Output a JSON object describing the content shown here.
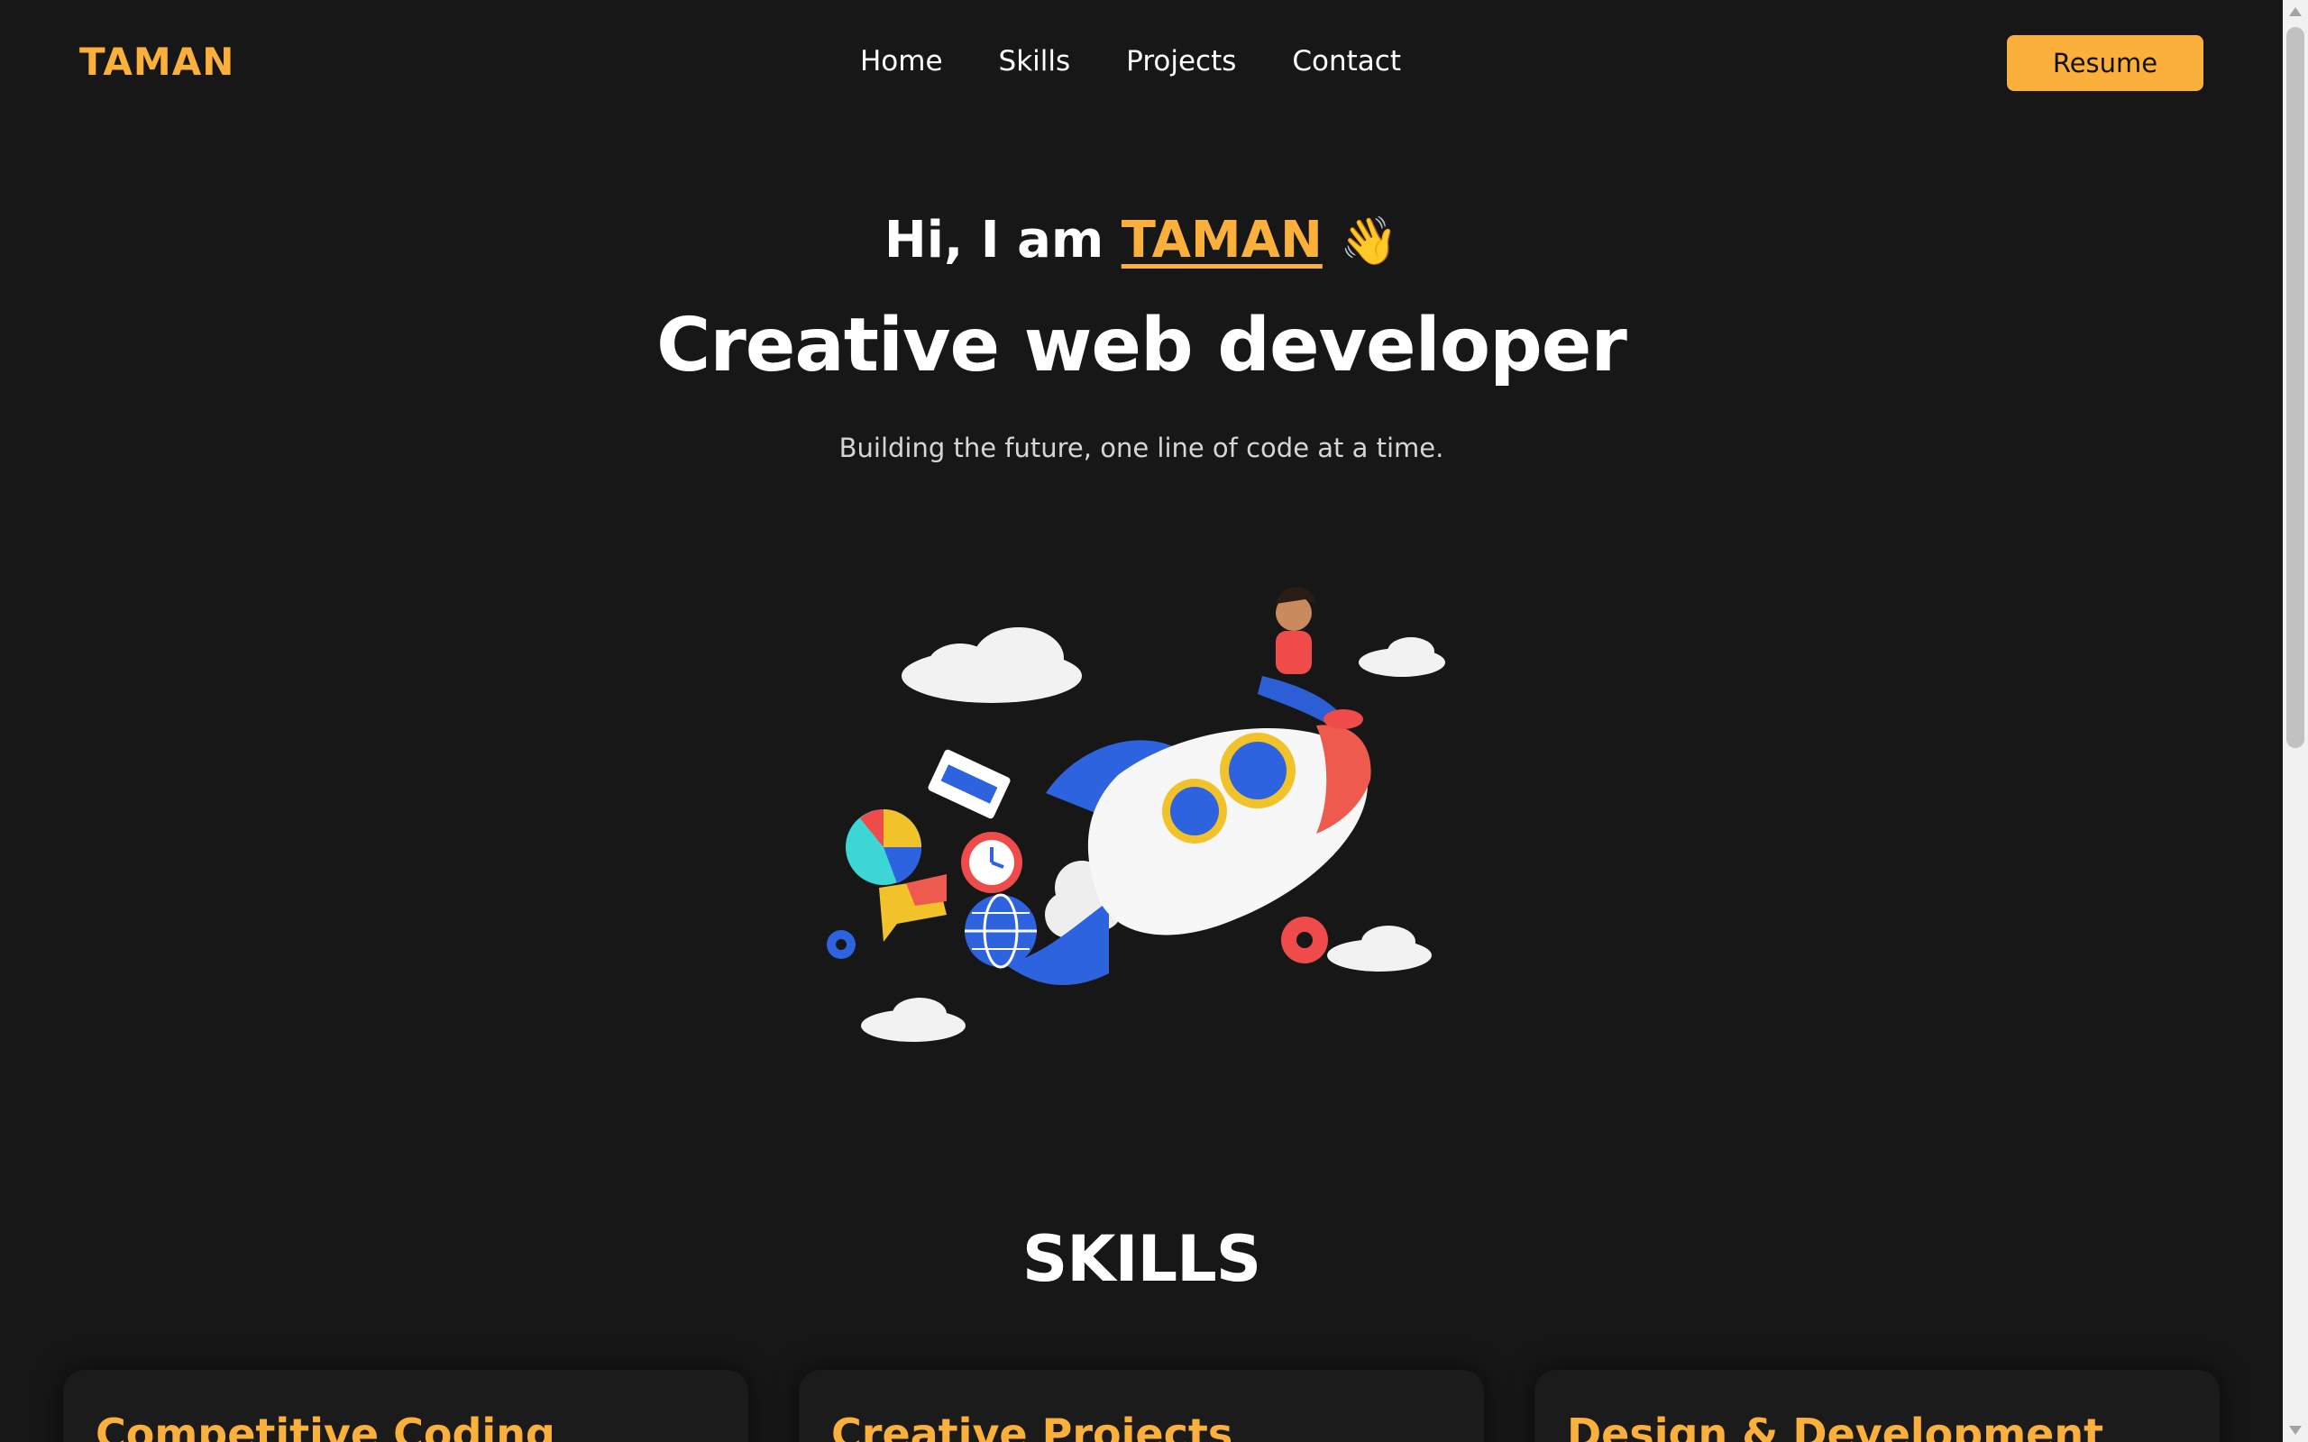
{
  "nav": {
    "logo": "TAMAN",
    "links": [
      "Home",
      "Skills",
      "Projects",
      "Contact"
    ],
    "resume_label": "Resume"
  },
  "hero": {
    "greeting_prefix": "Hi, I am ",
    "name": "TAMAN",
    "wave_emoji": "👋",
    "title": "Creative web developer",
    "subtitle": "Building the future, one line of code at a time.",
    "illustration": "rocket-rider-illustration"
  },
  "skills": {
    "heading": "SKILLS",
    "cards": [
      {
        "title": "Competitive Coding"
      },
      {
        "title": "Creative Projects"
      },
      {
        "title": "Design & Development"
      }
    ]
  },
  "colors": {
    "background": "#171718",
    "accent": "#fbb03b",
    "text": "#ffffff"
  }
}
